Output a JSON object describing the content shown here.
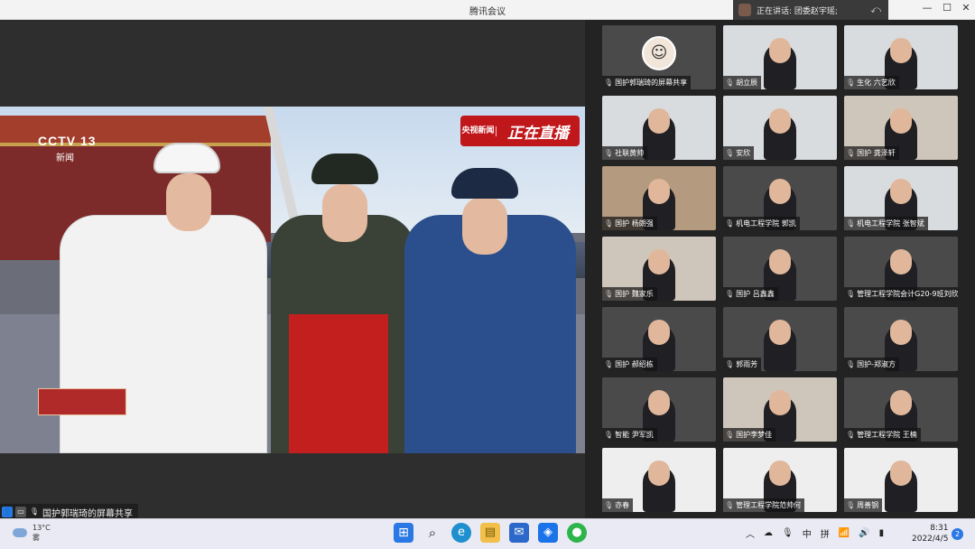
{
  "window": {
    "title": "腾讯会议",
    "speaking_label": "正在讲话: 团委赵宇瑶;",
    "controls": {
      "minimize": "—",
      "maximize": "☐",
      "close": "✕"
    }
  },
  "main": {
    "share_label": "国护郭瑞琦的屏幕共享",
    "broadcast": {
      "channel_logo": "CCTV 13",
      "channel_sub": "新闻",
      "badge_left": "央视新闻",
      "badge_right": "正在直播"
    }
  },
  "participants": [
    {
      "name": "国护郭瑞琦的屏幕共享",
      "style": "avatar"
    },
    {
      "name": "胡立辰",
      "style": "light"
    },
    {
      "name": "生化 六艺欣",
      "style": "light"
    },
    {
      "name": "社联黄帅",
      "style": "light"
    },
    {
      "name": "安欣",
      "style": "light"
    },
    {
      "name": "国护 龚泽轩",
      "style": "room"
    },
    {
      "name": "国护 杨朗强",
      "style": "warm"
    },
    {
      "name": "机电工程学院 郭凯",
      "style": "dark"
    },
    {
      "name": "机电工程学院 张智斌",
      "style": "light"
    },
    {
      "name": "国护 魏家乐",
      "style": "room"
    },
    {
      "name": "国护 吕鑫鑫",
      "style": "dark"
    },
    {
      "name": "管理工程学院会计G20-9班刘欣雨",
      "style": "dark"
    },
    {
      "name": "国护 郝绍栋",
      "style": "dark"
    },
    {
      "name": "郭雨芳",
      "style": "dark"
    },
    {
      "name": "国护-郑淑方",
      "style": "dark"
    },
    {
      "name": "智能 尹军凯",
      "style": "dark"
    },
    {
      "name": "国护李梦佳",
      "style": "room"
    },
    {
      "name": "管理工程学院  王楠",
      "style": "dark"
    },
    {
      "name": "亦春",
      "style": "white"
    },
    {
      "name": "管理工程学院范帅何",
      "style": "white"
    },
    {
      "name": "周善钢",
      "style": "white"
    }
  ],
  "taskbar": {
    "weather_temp": "13°C",
    "weather_desc": "雾",
    "tray_ime1": "中",
    "tray_ime2": "拼",
    "time": "8:31",
    "date": "2022/4/5",
    "notification_count": "2"
  },
  "colors": {
    "accent": "#2a78e4",
    "badge_red": "#c0171b"
  }
}
